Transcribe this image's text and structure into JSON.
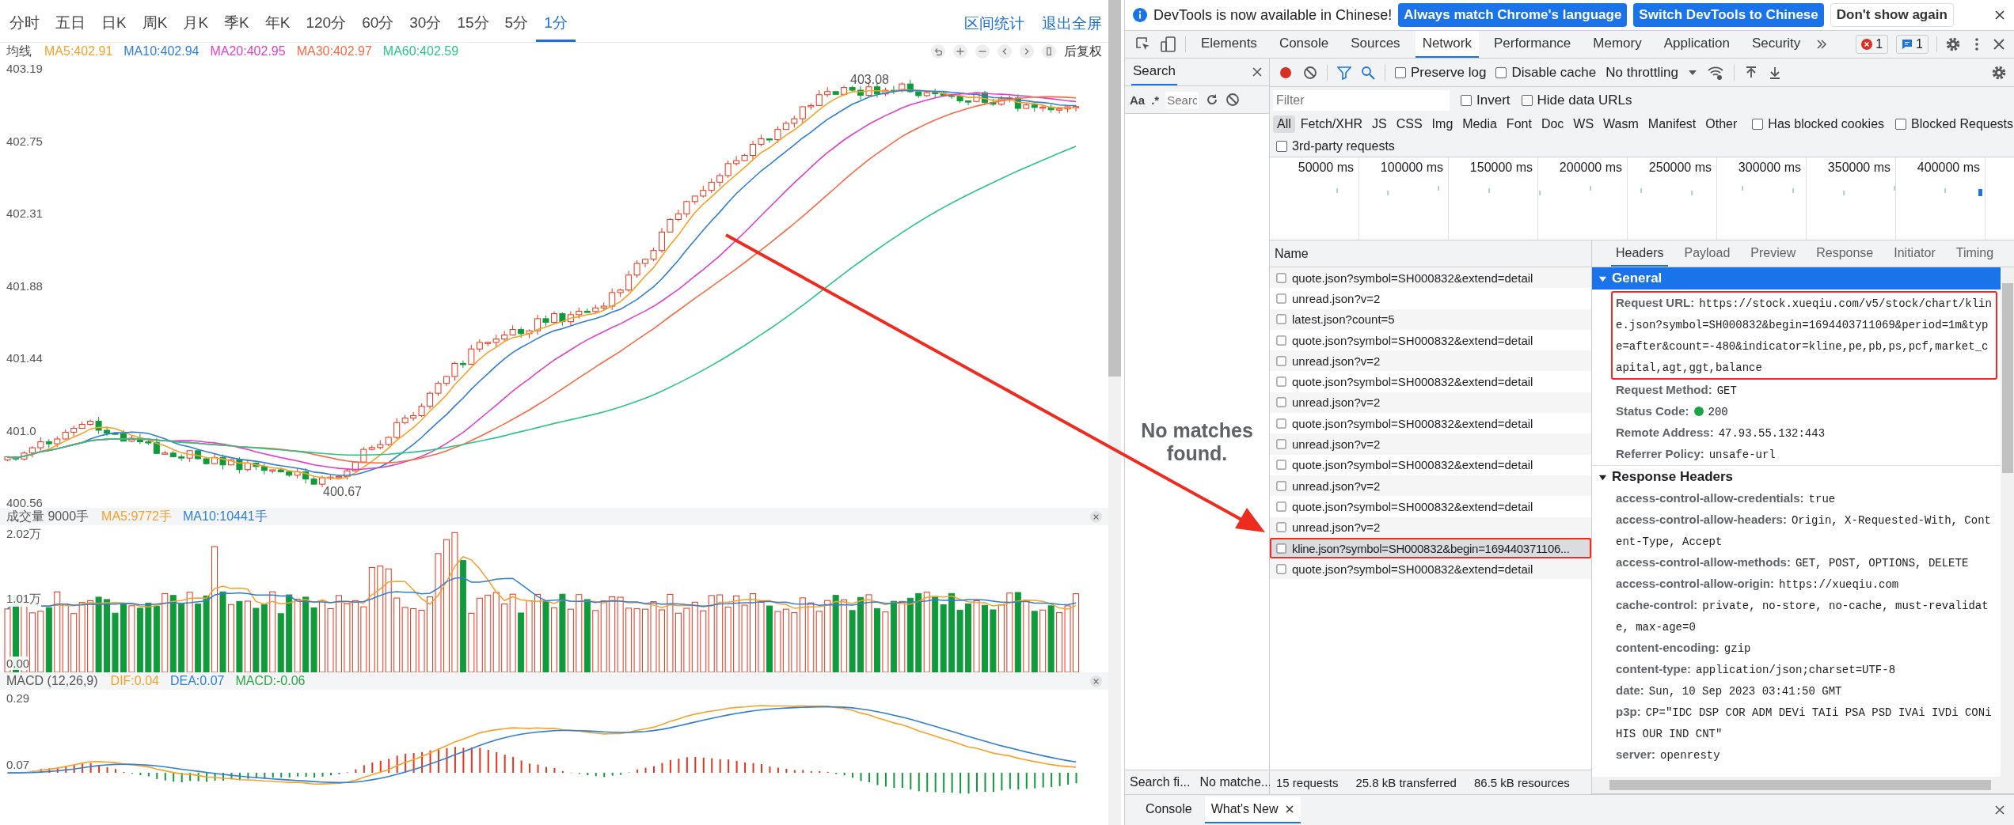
{
  "chart": {
    "period_tabs": [
      {
        "label": "分时",
        "selected": false
      },
      {
        "label": "五日",
        "selected": false
      },
      {
        "label": "日K",
        "selected": false
      },
      {
        "label": "周K",
        "selected": false
      },
      {
        "label": "月K",
        "selected": false
      },
      {
        "label": "季K",
        "selected": false
      },
      {
        "label": "年K",
        "selected": false
      },
      {
        "label": "120分",
        "selected": false
      },
      {
        "label": "60分",
        "selected": false
      },
      {
        "label": "30分",
        "selected": false
      },
      {
        "label": "15分",
        "selected": false
      },
      {
        "label": "5分",
        "selected": false
      },
      {
        "label": "1分",
        "selected": true
      }
    ],
    "actions": [
      "区间统计",
      "退出全屏"
    ],
    "ma_label": "均线",
    "ma_legend": [
      {
        "text": "MA5:402.91",
        "color": "#f7a128"
      },
      {
        "text": "MA10:402.94",
        "color": "#2f7ed8"
      },
      {
        "text": "MA20:402.95",
        "color": "#e040c8"
      },
      {
        "text": "MA30:402.97",
        "color": "#f76a45"
      },
      {
        "text": "MA60:402.59",
        "color": "#2bc487"
      }
    ],
    "adjust_label": "后复权",
    "price_yticks": [
      "403.19",
      "402.75",
      "402.31",
      "401.88",
      "401.44",
      "401.0",
      "400.56"
    ],
    "high_label": "403.08",
    "low_label": "400.67",
    "volume": {
      "title": "成交量 9000手",
      "legend": [
        {
          "text": "MA5:9772手",
          "color": "#f7a128"
        },
        {
          "text": "MA10:10441手",
          "color": "#2f7ed8"
        }
      ],
      "yticks": [
        "2.02万",
        "1.01万",
        "0.00"
      ]
    },
    "macd": {
      "title": "MACD (12,26,9)",
      "legend": [
        {
          "text": "DIF:0.04",
          "color": "#f7a128"
        },
        {
          "text": "DEA:0.07",
          "color": "#2f7ed8"
        },
        {
          "text": "MACD:-0.06",
          "color": "#27a844"
        }
      ],
      "yticks": [
        "0.29",
        "0.07"
      ]
    }
  },
  "devtools": {
    "infobar": {
      "message": "DevTools is now available in Chinese!",
      "buttons": [
        {
          "label": "Always match Chrome's language",
          "kind": "primary"
        },
        {
          "label": "Switch DevTools to Chinese",
          "kind": "primary"
        },
        {
          "label": "Don't show again",
          "kind": "plain"
        }
      ]
    },
    "tabs": [
      {
        "label": "Elements",
        "selected": false
      },
      {
        "label": "Console",
        "selected": false
      },
      {
        "label": "Sources",
        "selected": false
      },
      {
        "label": "Network",
        "selected": true
      },
      {
        "label": "Performance",
        "selected": false
      },
      {
        "label": "Memory",
        "selected": false
      },
      {
        "label": "Application",
        "selected": false
      },
      {
        "label": "Security",
        "selected": false
      }
    ],
    "error_count": "1",
    "message_count": "1",
    "search": {
      "title": "Search",
      "case_label": "Aa",
      "regex_label": ".*",
      "placeholder": "Searc",
      "empty_text": "No matches found.",
      "status": [
        "Search fi...",
        "No matche..."
      ]
    },
    "toolbar": {
      "checkboxes": [
        {
          "label": "Preserve log",
          "checked": false
        },
        {
          "label": "Disable cache",
          "checked": false
        }
      ],
      "throttling": "No throttling"
    },
    "filter": {
      "placeholder": "Filter",
      "checkboxes": [
        {
          "label": "Invert",
          "checked": false
        },
        {
          "label": "Hide data URLs",
          "checked": false
        }
      ]
    },
    "types": [
      {
        "label": "All",
        "selected": true
      },
      {
        "label": "Fetch/XHR",
        "selected": false
      },
      {
        "label": "JS",
        "selected": false
      },
      {
        "label": "CSS",
        "selected": false
      },
      {
        "label": "Img",
        "selected": false
      },
      {
        "label": "Media",
        "selected": false
      },
      {
        "label": "Font",
        "selected": false
      },
      {
        "label": "Doc",
        "selected": false
      },
      {
        "label": "WS",
        "selected": false
      },
      {
        "label": "Wasm",
        "selected": false
      },
      {
        "label": "Manifest",
        "selected": false
      },
      {
        "label": "Other",
        "selected": false
      }
    ],
    "type_checkboxes": [
      {
        "label": "Has blocked cookies",
        "checked": false
      },
      {
        "label": "Blocked Requests",
        "checked": false
      }
    ],
    "third_party": {
      "label": "3rd-party requests",
      "checked": false
    },
    "overview_ticks": [
      "50000 ms",
      "100000 ms",
      "150000 ms",
      "200000 ms",
      "250000 ms",
      "300000 ms",
      "350000 ms",
      "400000 ms"
    ],
    "name_header": "Name",
    "requests": [
      {
        "name": "quote.json?symbol=SH000832&extend=detail",
        "selected": false,
        "annotated": false
      },
      {
        "name": "unread.json?v=2",
        "selected": false,
        "annotated": false
      },
      {
        "name": "latest.json?count=5",
        "selected": false,
        "annotated": false
      },
      {
        "name": "quote.json?symbol=SH000832&extend=detail",
        "selected": false,
        "annotated": false
      },
      {
        "name": "unread.json?v=2",
        "selected": false,
        "annotated": false
      },
      {
        "name": "quote.json?symbol=SH000832&extend=detail",
        "selected": false,
        "annotated": false
      },
      {
        "name": "unread.json?v=2",
        "selected": false,
        "annotated": false
      },
      {
        "name": "quote.json?symbol=SH000832&extend=detail",
        "selected": false,
        "annotated": false
      },
      {
        "name": "unread.json?v=2",
        "selected": false,
        "annotated": false
      },
      {
        "name": "quote.json?symbol=SH000832&extend=detail",
        "selected": false,
        "annotated": false
      },
      {
        "name": "unread.json?v=2",
        "selected": false,
        "annotated": false
      },
      {
        "name": "quote.json?symbol=SH000832&extend=detail",
        "selected": false,
        "annotated": false
      },
      {
        "name": "unread.json?v=2",
        "selected": false,
        "annotated": false
      },
      {
        "name": "kline.json?symbol=SH000832&begin=169440371106...",
        "selected": true,
        "annotated": true
      },
      {
        "name": "quote.json?symbol=SH000832&extend=detail",
        "selected": false,
        "annotated": false
      }
    ],
    "summary": [
      "15 requests",
      "25.8 kB transferred",
      "86.5 kB resources"
    ],
    "detail_tabs": [
      {
        "label": "Headers",
        "selected": true
      },
      {
        "label": "Payload",
        "selected": false
      },
      {
        "label": "Preview",
        "selected": false
      },
      {
        "label": "Response",
        "selected": false
      },
      {
        "label": "Initiator",
        "selected": false
      },
      {
        "label": "Timing",
        "selected": false
      }
    ],
    "general": {
      "title": "General",
      "expanded": true,
      "rows": [
        {
          "kind": "plain",
          "label": "Request URL:",
          "value": "https://stock.xueqiu.com/v5/stock/chart/kline.json?symbol=SH000832&begin=1694403711069&period=1m&type=after&count=-480&indicator=kline,pe,pb,ps,pcf,market_capital,agt,ggt,balance",
          "annotated": true
        },
        {
          "kind": "plain",
          "label": "Request Method:",
          "value": "GET",
          "annotated": false
        },
        {
          "kind": "status",
          "label": "Status Code:",
          "value": "200",
          "color": "#1ea446",
          "annotated": false
        },
        {
          "kind": "plain",
          "label": "Remote Address:",
          "value": "47.93.55.132:443",
          "annotated": false
        },
        {
          "kind": "plain",
          "label": "Referrer Policy:",
          "value": "unsafe-url",
          "annotated": false
        }
      ]
    },
    "response_headers": {
      "title": "Response Headers",
      "expanded": true,
      "rows": [
        {
          "label": "access-control-allow-credentials:",
          "value": "true"
        },
        {
          "label": "access-control-allow-headers:",
          "value": "Origin, X-Requested-With, Content-Type, Accept"
        },
        {
          "label": "access-control-allow-methods:",
          "value": "GET, POST, OPTIONS, DELETE"
        },
        {
          "label": "access-control-allow-origin:",
          "value": "https://xueqiu.com"
        },
        {
          "label": "cache-control:",
          "value": "private, no-store, no-cache, must-revalidate, max-age=0"
        },
        {
          "label": "content-encoding:",
          "value": "gzip"
        },
        {
          "label": "content-type:",
          "value": "application/json;charset=UTF-8"
        },
        {
          "label": "date:",
          "value": "Sun, 10 Sep 2023 03:41:50 GMT"
        },
        {
          "label": "p3p:",
          "value": "CP=\"IDC DSP COR ADM DEVi TAIi PSA PSD IVAi IVDi CONi HIS OUR IND CNT\""
        },
        {
          "label": "server:",
          "value": "openresty"
        }
      ]
    },
    "drawer_tabs": [
      {
        "label": "Console",
        "selected": false
      },
      {
        "label": "What's New",
        "selected": true
      }
    ]
  }
}
